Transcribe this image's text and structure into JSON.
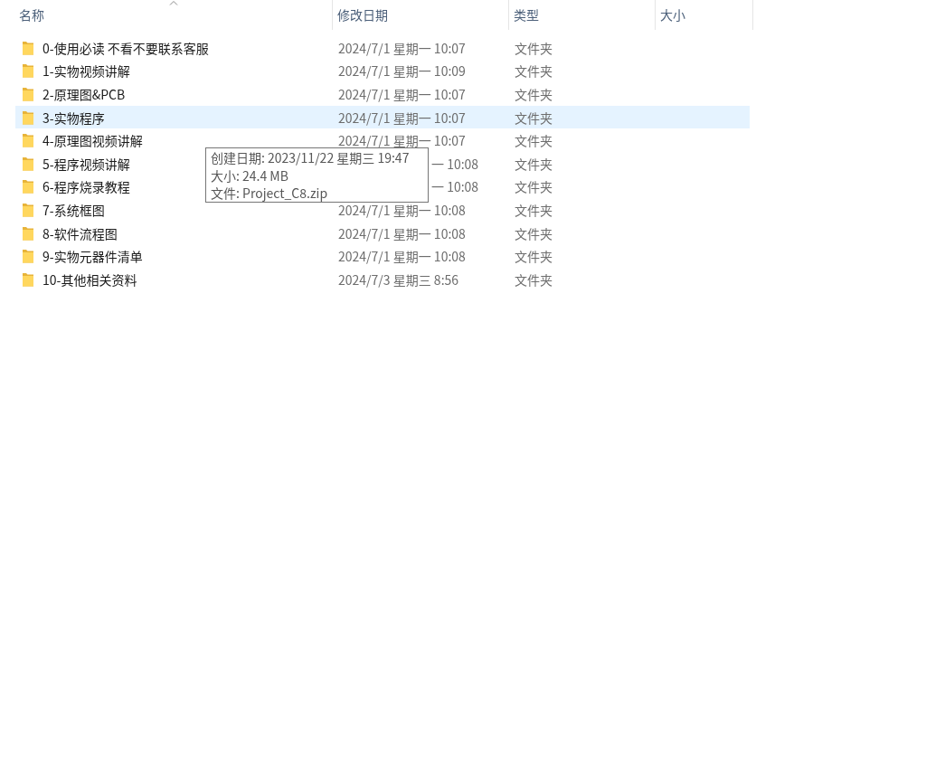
{
  "columns": [
    {
      "label": "名称",
      "sorted": true
    },
    {
      "label": "修改日期",
      "sorted": false
    },
    {
      "label": "类型",
      "sorted": false
    },
    {
      "label": "大小",
      "sorted": false
    }
  ],
  "rows": [
    {
      "name": "0-使用必读  不看不要联系客服",
      "date": "2024/7/1 星期一 10:07",
      "type": "文件夹",
      "selected": false,
      "date_under_tooltip": false
    },
    {
      "name": "1-实物视频讲解",
      "date": "2024/7/1 星期一 10:09",
      "type": "文件夹",
      "selected": false,
      "date_under_tooltip": false
    },
    {
      "name": "2-原理图&PCB",
      "date": "2024/7/1 星期一 10:07",
      "type": "文件夹",
      "selected": false,
      "date_under_tooltip": false
    },
    {
      "name": "3-实物程序",
      "date": "2024/7/1 星期一 10:07",
      "type": "文件夹",
      "selected": true,
      "date_under_tooltip": false
    },
    {
      "name": "4-原理图视频讲解",
      "date": "2024/7/1 星期一 10:07",
      "type": "文件夹",
      "selected": false,
      "date_under_tooltip": false
    },
    {
      "name": "5-程序视频讲解",
      "date": "一 10:08",
      "type": "文件夹",
      "selected": false,
      "date_under_tooltip": true
    },
    {
      "name": "6-程序烧录教程",
      "date": "一 10:08",
      "type": "文件夹",
      "selected": false,
      "date_under_tooltip": true
    },
    {
      "name": "7-系统框图",
      "date": "2024/7/1 星期一 10:08",
      "type": "文件夹",
      "selected": false,
      "date_under_tooltip": false
    },
    {
      "name": "8-软件流程图",
      "date": "2024/7/1 星期一 10:08",
      "type": "文件夹",
      "selected": false,
      "date_under_tooltip": false
    },
    {
      "name": "9-实物元器件清单",
      "date": "2024/7/1 星期一 10:08",
      "type": "文件夹",
      "selected": false,
      "date_under_tooltip": false
    },
    {
      "name": "10-其他相关资料",
      "date": "2024/7/3 星期三 8:56",
      "type": "文件夹",
      "selected": false,
      "date_under_tooltip": false
    }
  ],
  "tooltip": {
    "lines": [
      "创建日期: 2023/11/22 星期三 19:47",
      "大小: 24.4 MB",
      "文件: Project_C8.zip"
    ]
  }
}
